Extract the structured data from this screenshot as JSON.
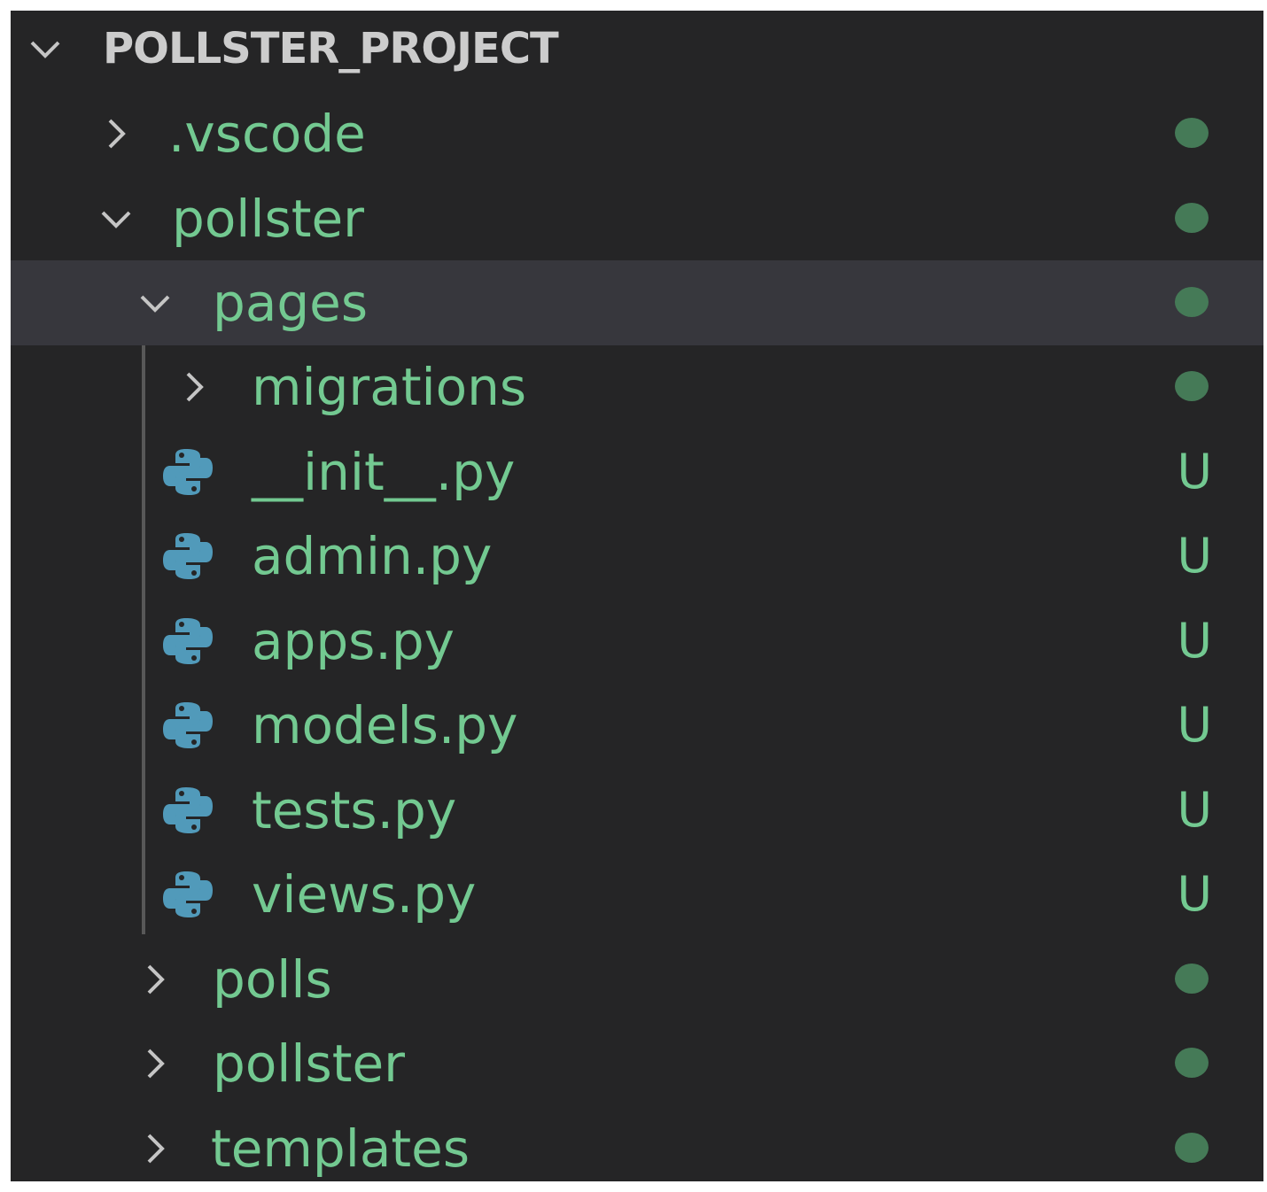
{
  "colors": {
    "background": "#252526",
    "selected_row": "#37373d",
    "root_text": "#cccccc",
    "folder_text": "#73c991",
    "file_text": "#73c991",
    "chevron": "#c5c5c5",
    "dot": "#457a57",
    "untracked_badge": "#73c991",
    "python_icon": "#519aba"
  },
  "explorer": {
    "root": {
      "label": "POLLSTER_PROJECT",
      "expanded": true,
      "icon": "chevron-down-icon"
    },
    "items": [
      {
        "label": ".vscode",
        "kind": "folder",
        "expanded": false,
        "depth": 1,
        "decoration": "dot",
        "icon": "chevron-right-icon"
      },
      {
        "label": "pollster",
        "kind": "folder",
        "expanded": true,
        "depth": 1,
        "decoration": "dot",
        "icon": "chevron-down-icon"
      },
      {
        "label": "pages",
        "kind": "folder",
        "expanded": true,
        "depth": 2,
        "decoration": "dot",
        "selected": true,
        "icon": "chevron-down-icon"
      },
      {
        "label": "migrations",
        "kind": "folder",
        "expanded": false,
        "depth": 3,
        "decoration": "dot",
        "icon": "chevron-right-icon"
      },
      {
        "label": "__init__.py",
        "kind": "file",
        "depth": 3,
        "badge": "U",
        "icon": "python-file-icon"
      },
      {
        "label": "admin.py",
        "kind": "file",
        "depth": 3,
        "badge": "U",
        "icon": "python-file-icon"
      },
      {
        "label": "apps.py",
        "kind": "file",
        "depth": 3,
        "badge": "U",
        "icon": "python-file-icon"
      },
      {
        "label": "models.py",
        "kind": "file",
        "depth": 3,
        "badge": "U",
        "icon": "python-file-icon"
      },
      {
        "label": "tests.py",
        "kind": "file",
        "depth": 3,
        "badge": "U",
        "icon": "python-file-icon"
      },
      {
        "label": "views.py",
        "kind": "file",
        "depth": 3,
        "badge": "U",
        "icon": "python-file-icon"
      },
      {
        "label": "polls",
        "kind": "folder",
        "expanded": false,
        "depth": 2,
        "decoration": "dot",
        "icon": "chevron-right-icon"
      },
      {
        "label": "pollster",
        "kind": "folder",
        "expanded": false,
        "depth": 2,
        "decoration": "dot",
        "icon": "chevron-right-icon"
      },
      {
        "label": "templates",
        "kind": "folder",
        "expanded": false,
        "depth": 2,
        "decoration": "dot",
        "icon": "chevron-right-icon"
      }
    ]
  }
}
